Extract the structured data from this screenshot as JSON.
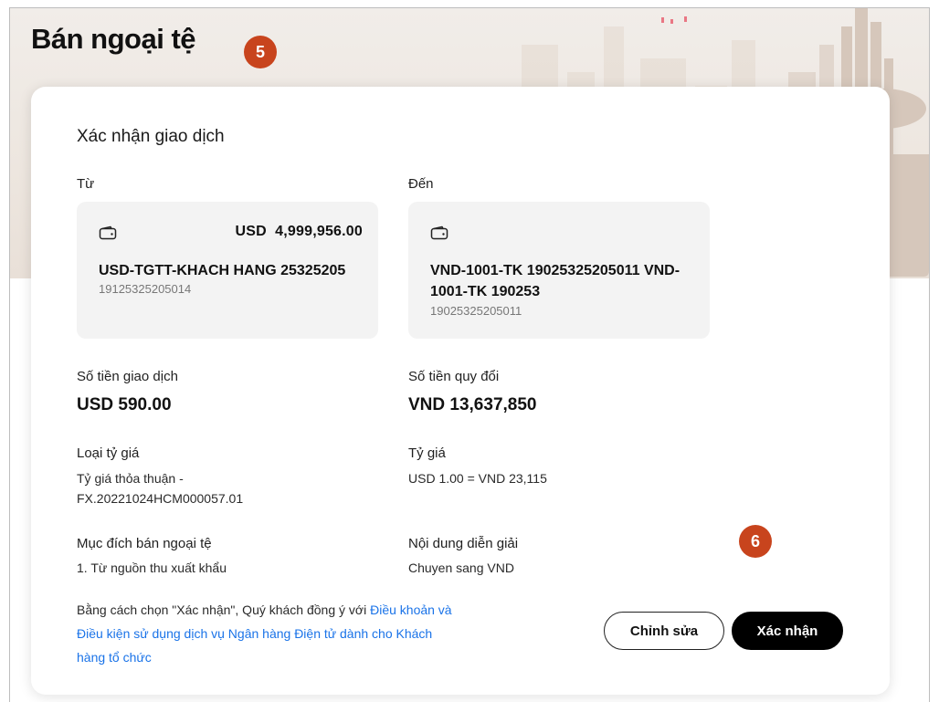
{
  "page": {
    "title": "Bán ngoại tệ"
  },
  "steps": {
    "badge_1": "5",
    "badge_2": "6"
  },
  "card": {
    "title": "Xác nhận giao dịch"
  },
  "from": {
    "label": "Từ",
    "icon": "wallet-icon",
    "balance": "USD  4,999,956.00",
    "account_name": "USD-TGTT-KHACH HANG 25325205",
    "account_number": "19125325205014"
  },
  "to": {
    "label": "Đến",
    "icon": "wallet-icon",
    "account_name": "VND-1001-TK 19025325205011 VND-1001-TK 190253",
    "account_number": "19025325205011"
  },
  "transaction": {
    "amount_label": "Số tiền giao dịch",
    "amount_value": "USD 590.00",
    "converted_label": "Số tiền quy đổi",
    "converted_value": "VND 13,637,850",
    "rate_type_label": "Loại tỷ giá",
    "rate_type_value": "Tỷ giá thỏa thuận - FX.20221024HCM000057.01",
    "rate_label": "Tỷ giá",
    "rate_value": "USD 1.00 = VND 23,115",
    "purpose_label": "Mục đích bán ngoại tệ",
    "purpose_value": "1. Từ nguồn thu xuất khẩu",
    "description_label": "Nội dung diễn giải",
    "description_value": "Chuyen sang VND"
  },
  "terms": {
    "prefix": "Bằng cách chọn \"Xác nhận\", Quý khách đồng ý với ",
    "link": "Điều khoản và Điều kiện sử dụng dịch vụ Ngân hàng Điện tử dành cho Khách hàng tổ chức"
  },
  "buttons": {
    "edit": "Chỉnh sửa",
    "confirm": "Xác nhận"
  },
  "colors": {
    "badge": "#c8441d",
    "link": "#1a73e8",
    "primary_button": "#000000",
    "panel": "#f3f3f3"
  }
}
